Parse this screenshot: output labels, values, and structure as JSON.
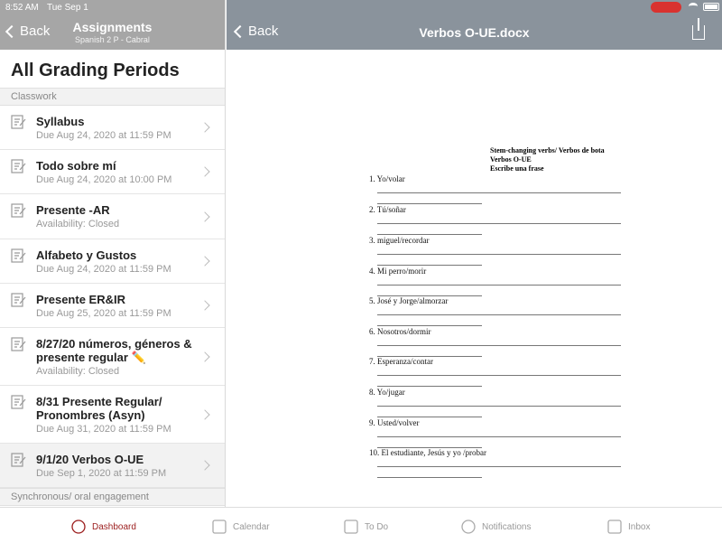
{
  "status": {
    "time": "8:52 AM",
    "date": "Tue Sep 1"
  },
  "left_header": {
    "back": "Back",
    "title": "Assignments",
    "subtitle": "Spanish 2 P - Cabral"
  },
  "right_header": {
    "back": "Back",
    "title": "Verbos O-UE.docx"
  },
  "grading_title": "All Grading Periods",
  "sections": [
    "Classwork",
    "Synchronous/ oral engagement"
  ],
  "assignments": [
    {
      "title": "Syllabus",
      "sub": "Due Aug 24, 2020 at 11:59 PM",
      "icon": "assignment-icon"
    },
    {
      "title": "Todo sobre mí",
      "sub": "Due Aug 24, 2020 at 10:00 PM",
      "icon": "discussion-icon"
    },
    {
      "title": "Presente -AR",
      "sub": "Availability: Closed",
      "icon": "assignment-icon"
    },
    {
      "title": "Alfabeto y Gustos",
      "sub": "Due Aug 24, 2020 at 11:59 PM",
      "icon": "assignment-icon"
    },
    {
      "title": "Presente ER&IR",
      "sub": "Due Aug 25, 2020 at 11:59 PM",
      "icon": "assignment-icon"
    },
    {
      "title": "8/27/20 números, géneros & presente regular ✏️",
      "sub": "Availability: Closed",
      "icon": "assignment-icon"
    },
    {
      "title": "8/31 Presente Regular/ Pronombres (Asyn)",
      "sub": "Due Aug 31, 2020 at 11:59 PM",
      "icon": "assignment-icon"
    },
    {
      "title": "9/1/20 Verbos O-UE",
      "sub": "Due Sep 1, 2020 at 11:59 PM",
      "icon": "assignment-icon",
      "selected": true
    }
  ],
  "document": {
    "heading": [
      "Stem-changing verbs/ Verbos de bota",
      "Verbos O-UE",
      "Escribe una frase"
    ],
    "items": [
      "1. Yo/volar",
      "2. Tú/soñar",
      "3. miguel/recordar",
      "4. Mi perro/morir",
      "5.  José y Jorge/almorzar",
      "6. Nosotros/dormir",
      "7. Esperanza/contar",
      "8. Yo/jugar",
      "9. Usted/volver",
      "10.  El estudiante, Jesús y yo /probar"
    ]
  },
  "tabs": [
    {
      "label": "Dashboard",
      "icon": "dashboard-icon",
      "active": true
    },
    {
      "label": "Calendar",
      "icon": "calendar-icon"
    },
    {
      "label": "To Do",
      "icon": "todo-icon"
    },
    {
      "label": "Notifications",
      "icon": "bell-icon"
    },
    {
      "label": "Inbox",
      "icon": "inbox-icon"
    }
  ],
  "colors": {
    "accent": "#9b1c1c",
    "left_header": "#a6a6a6",
    "right_header": "#8a939c",
    "mic": "#d9322f"
  }
}
